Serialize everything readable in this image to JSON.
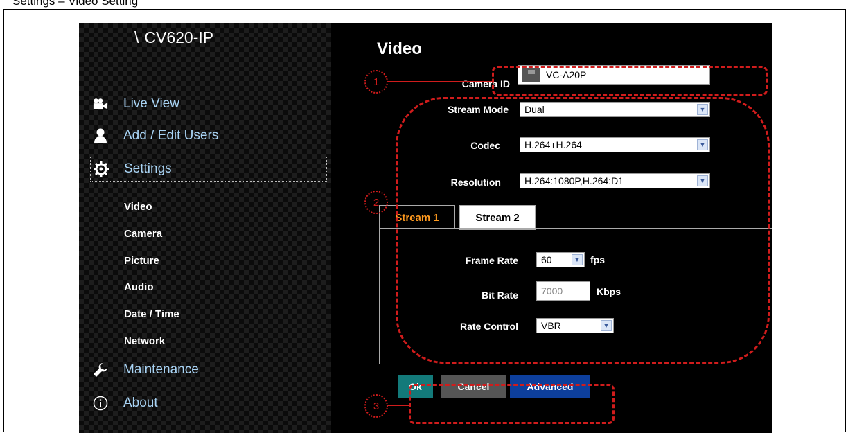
{
  "caption": "Settings – Video Setting",
  "brand": {
    "slash": "\\",
    "name": "CV620-IP"
  },
  "nav": {
    "live_view": "Live View",
    "add_edit_users": "Add / Edit Users",
    "settings": "Settings",
    "maintenance": "Maintenance",
    "about": "About"
  },
  "settings_sub": [
    "Video",
    "Camera",
    "Picture",
    "Audio",
    "Date / Time",
    "Network"
  ],
  "page": {
    "title": "Video",
    "camera_id_label": "Camera ID",
    "camera_id_value": "VC-A20P",
    "stream_mode_label": "Stream Mode",
    "stream_mode_value": "Dual",
    "codec_label": "Codec",
    "codec_value": "H.264+H.264",
    "resolution_label": "Resolution",
    "resolution_value": "H.264:1080P,H.264:D1"
  },
  "tabs": [
    "Stream 1",
    "Stream 2"
  ],
  "stream": {
    "frame_rate_label": "Frame Rate",
    "frame_rate_value": "60",
    "frame_rate_unit": "fps",
    "bit_rate_label": "Bit Rate",
    "bit_rate_value": "7000",
    "bit_rate_unit": "Kbps",
    "rate_control_label": "Rate Control",
    "rate_control_value": "VBR"
  },
  "buttons": {
    "ok": "Ok",
    "cancel": "Cancel",
    "advanced": "Advanced"
  },
  "callouts": [
    "1",
    "2",
    "3"
  ],
  "colors": {
    "accent_tab": "#ff9a1f",
    "ok": "#137a7a",
    "advanced": "#0d3f9c",
    "callout": "#d01c1c",
    "nav_text": "#a9d4f5"
  }
}
